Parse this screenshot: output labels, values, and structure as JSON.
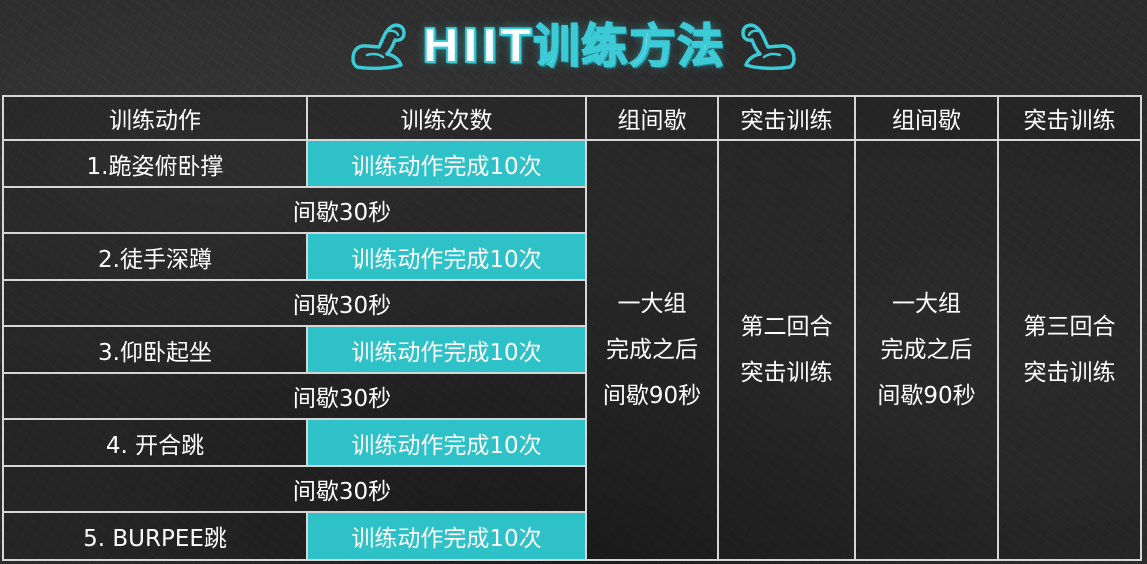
{
  "title": "HIIT训练方法",
  "headers": [
    "训练动作",
    "训练次数",
    "组间歇",
    "突击训练",
    "组间歇",
    "突击训练"
  ],
  "exercises": [
    {
      "name": "1.跪姿俯卧撑",
      "reps": "训练动作完成10次"
    },
    {
      "name": "2.徒手深蹲",
      "reps": "训练动作完成10次"
    },
    {
      "name": "3.仰卧起坐",
      "reps": "训练动作完成10次"
    },
    {
      "name": "4. 开合跳",
      "reps": "训练动作完成10次"
    },
    {
      "name": "5. BURPEE跳",
      "reps": "训练动作完成10次"
    }
  ],
  "rests": [
    "间歇30秒",
    "间歇30秒",
    "间歇30秒",
    "间歇30秒"
  ],
  "group_rest_1": [
    "一大组",
    "完成之后",
    "间歇90秒"
  ],
  "round_2": [
    "第二回合",
    "突击训练"
  ],
  "group_rest_2": [
    "一大组",
    "完成之后",
    "间歇90秒"
  ],
  "round_3": [
    "第三回合",
    "突击训练"
  ],
  "colors": {
    "accent": "#2ec2c8",
    "title_outline": "#3ccad6",
    "border": "#d6d6d6",
    "background": "#2b2b2b"
  },
  "icons": [
    "flexed-arm-icon",
    "flexed-arm-icon"
  ]
}
